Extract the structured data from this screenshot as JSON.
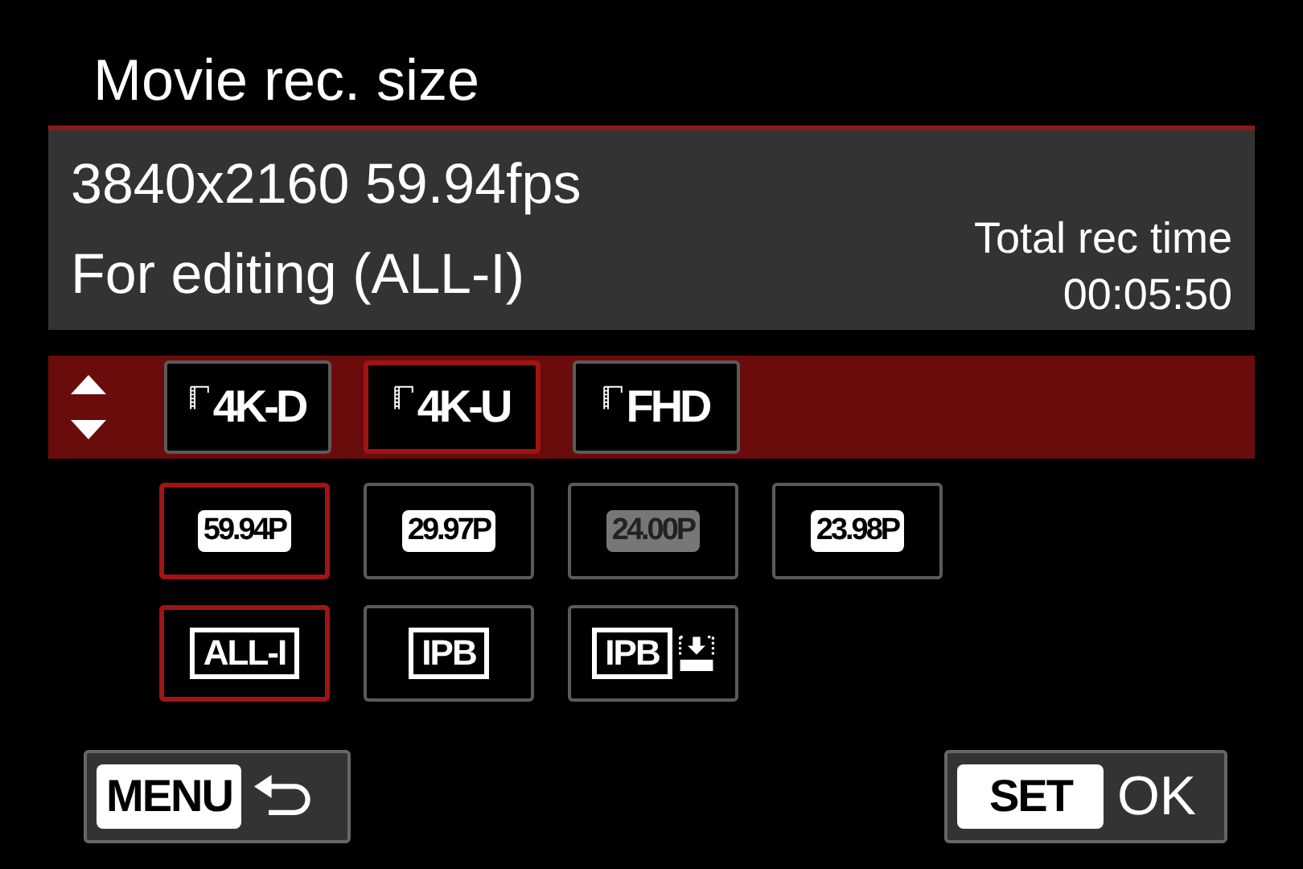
{
  "title": "Movie rec. size",
  "info": {
    "resolution": "3840x2160 59.94fps",
    "compression": "For editing (ALL-I)",
    "rec_time_label": "Total rec time",
    "rec_time": "00:05:50"
  },
  "sizes": [
    {
      "label": "4K-D",
      "selected": false
    },
    {
      "label": "4K-U",
      "selected": true
    },
    {
      "label": "FHD",
      "selected": false
    }
  ],
  "frame_rates": [
    {
      "label": "59.94P",
      "selected": true,
      "disabled": false
    },
    {
      "label": "29.97P",
      "selected": false,
      "disabled": false
    },
    {
      "label": "24.00P",
      "selected": false,
      "disabled": true
    },
    {
      "label": "23.98P",
      "selected": false,
      "disabled": false
    }
  ],
  "compressions": [
    {
      "label": "ALL-I",
      "kind": "plain",
      "selected": true
    },
    {
      "label": "IPB",
      "kind": "plain",
      "selected": false
    },
    {
      "label": "IPB",
      "kind": "light",
      "selected": false
    }
  ],
  "back_button": {
    "key": "MENU"
  },
  "ok_button": {
    "key": "SET",
    "label": "OK"
  }
}
